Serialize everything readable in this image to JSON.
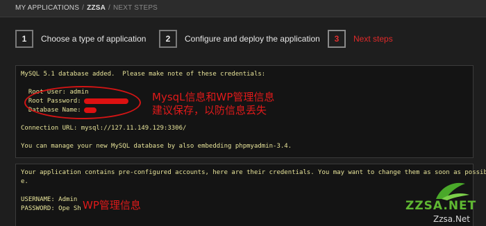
{
  "breadcrumb": {
    "root": "MY APPLICATIONS",
    "separator": "/",
    "app": "ZZSA",
    "current": "NEXT STEPS"
  },
  "steps": [
    {
      "number": "1",
      "label": "Choose a type of application"
    },
    {
      "number": "2",
      "label": "Configure and deploy the application"
    },
    {
      "number": "3",
      "label": "Next steps"
    }
  ],
  "credentials_panel": {
    "intro": "MySQL 5.1 database added.  Please make note of these credentials:",
    "root_user": "  Root User: admin",
    "root_password_label": "  Root Password:",
    "database_name_label": "  Database Name:",
    "connection_url": "Connection URL: mysql://127.11.149.129:3306/",
    "manage_note": "You can manage your new MySQL database by also embedding phpmyadmin-3.4."
  },
  "accounts_panel": {
    "line1": "Your application contains pre-configured accounts, here are their credentials. You may want to change them as soon as possibl",
    "line2": "e.",
    "username": "USERNAME: Admin",
    "password": "PASSWORD: Ope Sh"
  },
  "annotations": {
    "mysql_note_line1": "MysqL信息和WP管理信息",
    "mysql_note_line2": "建议保存，以防信息丢失",
    "wp_note": "WP管理信息"
  },
  "watermark": {
    "main": "ZZSA.NET",
    "sub": "Zzsa.Net"
  },
  "colors": {
    "active_step": "#e02a2a",
    "console_text": "#e8e49a",
    "annotation": "#e01a1a",
    "background": "#1e1e1e"
  }
}
